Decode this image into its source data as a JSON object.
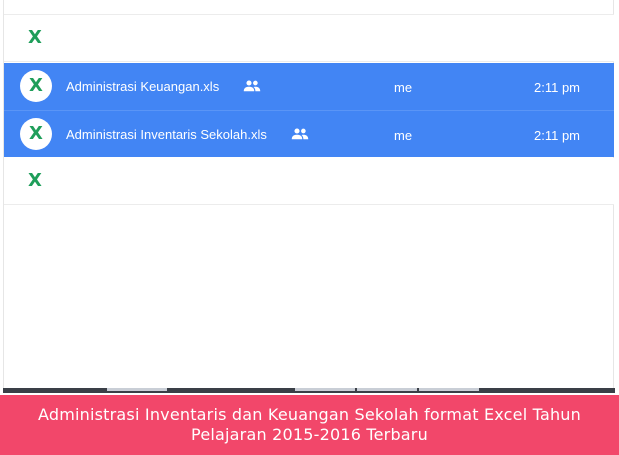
{
  "files": {
    "rows": [
      {
        "name": "Administrasi Keuangan.xls",
        "owner": "me",
        "modified": "2:11 pm",
        "icon": "excel-icon",
        "shared_icon": "people-icon",
        "selected": true
      },
      {
        "name": "Administrasi Inventaris Sekolah.xls",
        "owner": "me",
        "modified": "2:11 pm",
        "icon": "excel-icon",
        "shared_icon": "people-icon",
        "selected": true
      }
    ],
    "icon_glyph": "X",
    "colors": {
      "selected_row": "#4285f4",
      "excel_green": "#1f9e5a"
    }
  },
  "caption": {
    "text": "Administrasi Inventaris dan Keuangan Sekolah format Excel Tahun Pelajaran 2015-2016 Terbaru",
    "background": "#f2476a"
  }
}
